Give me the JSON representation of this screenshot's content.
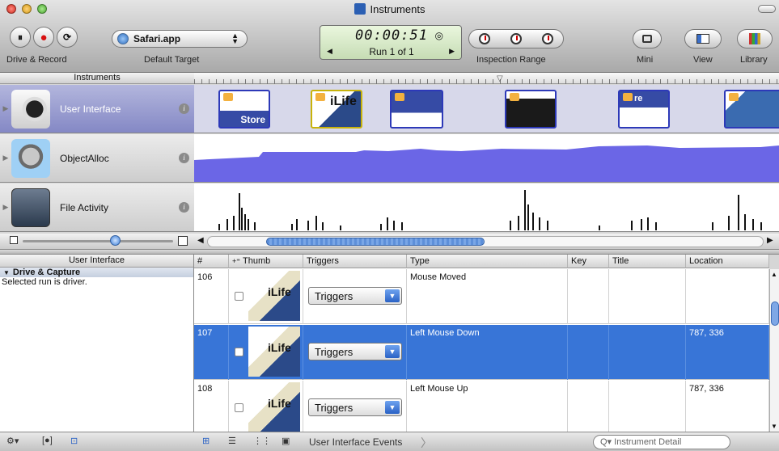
{
  "window": {
    "title": "Instruments"
  },
  "toolbar": {
    "drive_record_label": "Drive & Record",
    "target_app": "Safari.app",
    "default_target_label": "Default Target",
    "time": "00:00:51",
    "run": "Run 1 of 1",
    "inspection_range_label": "Inspection Range",
    "mini_label": "Mini",
    "view_label": "View",
    "library_label": "Library"
  },
  "instruments_header": "Instruments",
  "instruments": [
    {
      "name": "User Interface",
      "info": "i"
    },
    {
      "name": "ObjectAlloc",
      "info": "i"
    },
    {
      "name": "File Activity",
      "info": "i"
    }
  ],
  "ui_track": {
    "cards": [
      {
        "label": "Store"
      },
      {
        "label": "iLife"
      },
      {
        "label": ""
      },
      {
        "label": ""
      },
      {
        "label": "re"
      },
      {
        "label": ""
      }
    ]
  },
  "detail": {
    "pane_title": "User Interface",
    "section": "Drive & Capture",
    "section_text": "Selected run is driver.",
    "columns": [
      "#",
      "Thumb",
      "Triggers",
      "Type",
      "Key",
      "Title",
      "Location"
    ],
    "rows": [
      {
        "num": "106",
        "thumb": "iLife",
        "trigger": "Triggers",
        "type": "Mouse Moved",
        "key": "",
        "title": "",
        "location": "",
        "selected": false
      },
      {
        "num": "107",
        "thumb": "iLife",
        "trigger": "Triggers",
        "type": "Left Mouse Down",
        "key": "",
        "title": "",
        "location": "787, 336",
        "selected": true
      },
      {
        "num": "108",
        "thumb": "iLife",
        "trigger": "Triggers",
        "type": "Left Mouse Up",
        "key": "",
        "title": "",
        "location": "787, 336",
        "selected": false
      }
    ]
  },
  "statusbar": {
    "breadcrumb": "User Interface Events",
    "search_placeholder": "Instrument Detail"
  },
  "colors": {
    "selection": "#3875d7",
    "track_fill": "#6b66e6"
  }
}
